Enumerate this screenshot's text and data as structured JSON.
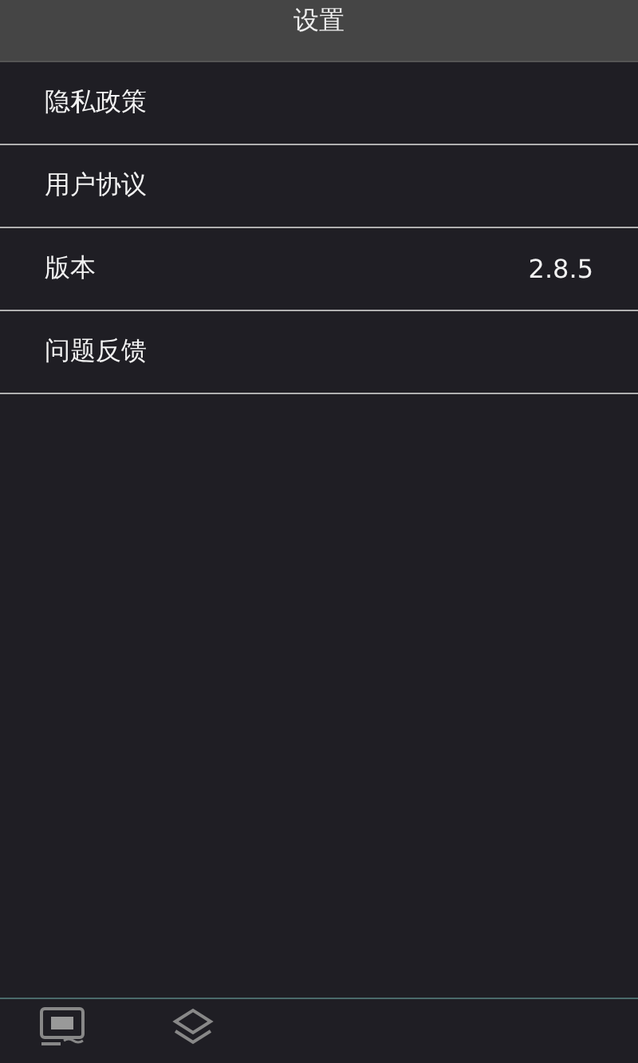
{
  "header": {
    "title": "设置"
  },
  "items": [
    {
      "label": "隐私政策"
    },
    {
      "label": "用户协议"
    },
    {
      "label": "版本",
      "value": "2.8.5"
    },
    {
      "label": "问题反馈"
    }
  ],
  "tab_bar": {
    "tabs": [
      {
        "kind": "screen"
      },
      {
        "kind": "layers"
      }
    ]
  }
}
